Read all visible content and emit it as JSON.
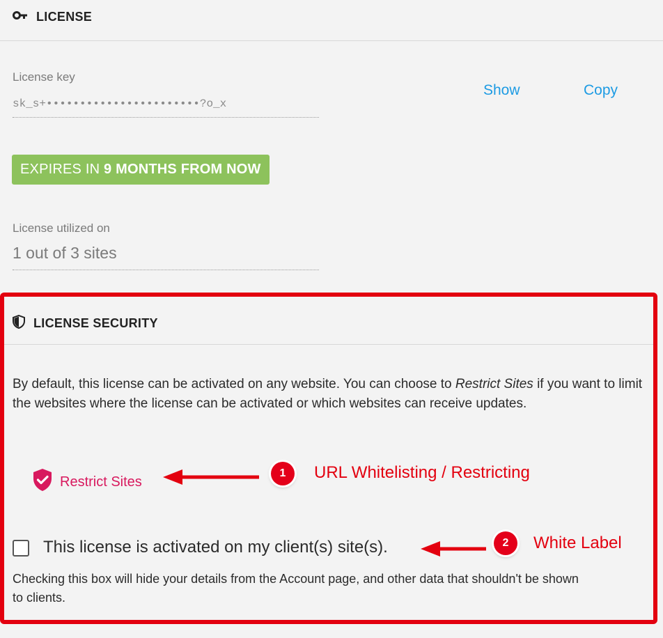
{
  "license": {
    "header": "LICENSE",
    "key_label": "License key",
    "key_value": "sk_s+•••••••••••••••••••••••?o_x",
    "show_label": "Show",
    "copy_label": "Copy",
    "expires_prefix": "EXPIRES IN ",
    "expires_strong": "9 MONTHS FROM NOW",
    "utilized_label": "License utilized on",
    "utilized_value": "1 out of 3 sites"
  },
  "security": {
    "header": "LICENSE SECURITY",
    "description_part1": "By default, this license can be activated on any website. You can choose to ",
    "description_italic": "Restrict Sites",
    "description_part2": " if you want to limit the websites where the license can be activated or which websites can receive updates.",
    "restrict_label": "Restrict Sites",
    "checkbox_label": "This license is activated on my client(s) site(s).",
    "checkbox_checked": false,
    "checkbox_help": "Checking this box will hide your details from the Account page, and other data that shouldn't be shown to clients."
  },
  "annotations": [
    {
      "number": "1",
      "text": "URL Whitelisting / Restricting"
    },
    {
      "number": "2",
      "text": "White Label"
    }
  ],
  "colors": {
    "accent_blue": "#1d9be3",
    "badge_green": "#8dc25c",
    "restrict_pink": "#d8195e",
    "annotation_red": "#e3000f"
  },
  "icons": {
    "license_header": "key-icon",
    "security_header": "shield-icon",
    "restrict": "shield-check-icon"
  }
}
